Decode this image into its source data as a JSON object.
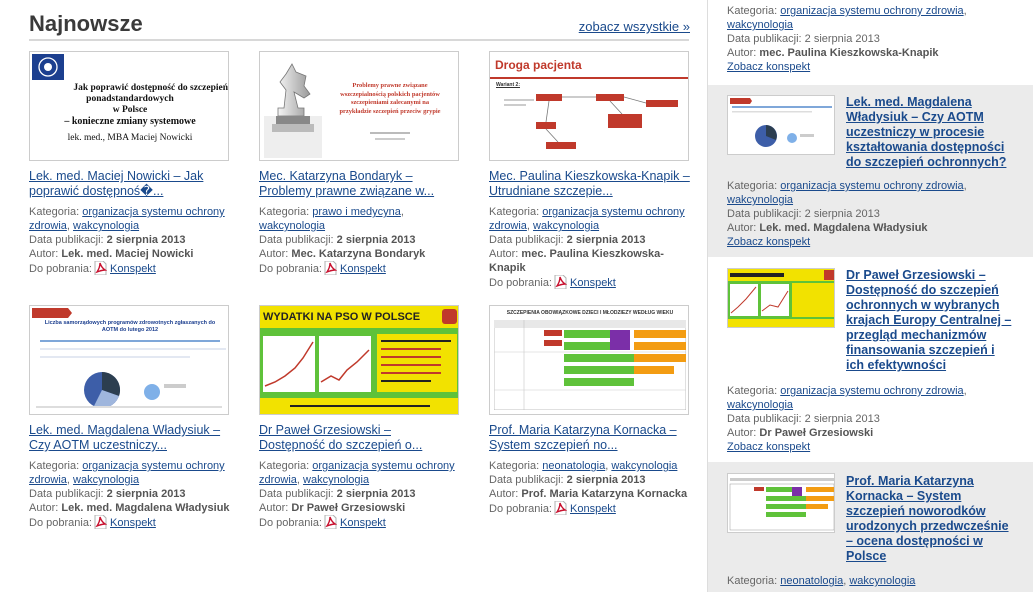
{
  "main": {
    "title": "Najnowsze",
    "see_all": "zobacz wszystkie »",
    "labels": {
      "category": "Kategoria:",
      "date": "Data publikacji:",
      "author": "Autor:",
      "download": "Do pobrania:"
    },
    "cards": [
      {
        "title": "Lek. med. Maciej Nowicki – Jak poprawić dostępnoś�...",
        "categories": [
          "organizacja systemu ochrony zdrowia",
          "wakcynologia"
        ],
        "date": "2 sierpnia 2013",
        "author": "Lek. med. Maciej Nowicki",
        "download": "Konspekt",
        "thumb": {
          "lines": [
            "Jak poprawić dostępność do szczepień",
            "ponadstandardowych",
            "w Polsce",
            "– konieczne zmiany systemowe",
            "lek. med., MBA Maciej Nowicki"
          ]
        }
      },
      {
        "title": "Mec. Katarzyna Bondaryk – Problemy prawne związane w...",
        "categories": [
          "prawo i medycyna",
          "wakcynologia"
        ],
        "date": "2 sierpnia 2013",
        "author": "Mec. Katarzyna Bondaryk",
        "download": "Konspekt",
        "thumb": {
          "lines": [
            "Problemy prawne związane",
            "wszczepialnością polskich pacjentów",
            "szczepieniami zalecanymi na",
            "przykładzie szczepień przeciw grypie"
          ]
        }
      },
      {
        "title": "Mec. Paulina Kieszkowska-Knapik – Utrudniane szczepie...",
        "categories": [
          "organizacja systemu ochrony zdrowia",
          "wakcynologia"
        ],
        "date": "2 sierpnia 2013",
        "author": "mec. Paulina Kieszkowska-Knapik",
        "download": "Konspekt",
        "thumb": {
          "lines": [
            "Droga pacjenta",
            "Wariant 2:"
          ]
        }
      },
      {
        "title": "Lek. med. Magdalena Władysiuk – Czy AOTM uczestniczy...",
        "categories": [
          "organizacja systemu ochrony zdrowia",
          "wakcynologia"
        ],
        "date": "2 sierpnia 2013",
        "author": "Lek. med. Magdalena Władysiuk",
        "download": "Konspekt",
        "thumb": {
          "lines": [
            "Liczba samorządowych programów zdrowotnych zgłaszanych do",
            "AOTM do lutego 2012"
          ]
        }
      },
      {
        "title": "Dr Paweł Grzesiowski – Dostępność do szczepień o...",
        "categories": [
          "organizacja systemu ochrony zdrowia",
          "wakcynologia"
        ],
        "date": "2 sierpnia 2013",
        "author": "Dr Paweł Grzesiowski",
        "download": "Konspekt",
        "thumb": {
          "lines": [
            "WYDATKI NA PSO W POLSCE"
          ]
        }
      },
      {
        "title": "Prof. Maria Katarzyna Kornacka – System szczepień no...",
        "categories": [
          "neonatologia",
          "wakcynologia"
        ],
        "date": "2 sierpnia 2013",
        "author": "Prof. Maria Katarzyna Kornacka",
        "download": "Konspekt",
        "thumb": {
          "lines": [
            "SZCZEPIENIA OBOWIĄZKOWE DZIECI I MŁODZIEŻY WEDŁUG WIEKU"
          ]
        }
      }
    ]
  },
  "sidebar": {
    "labels": {
      "category": "Kategoria:",
      "date": "Data publikacji:",
      "author": "Autor:",
      "more": "Zobacz konspekt"
    },
    "top": {
      "categories": [
        "organizacja systemu ochrony zdrowia",
        "wakcynologia"
      ],
      "date": "2 sierpnia 2013",
      "author": "mec. Paulina Kieszkowska-Knapik",
      "more": "Zobacz konspekt"
    },
    "items": [
      {
        "title": "Lek. med. Magdalena Władysiuk – Czy AOTM uczestniczy w procesie kształtowania dostępności do szczepień ochronnych?",
        "categories": [
          "organizacja systemu ochrony zdrowia",
          "wakcynologia"
        ],
        "date": "2 sierpnia 2013",
        "author": "Lek. med. Magdalena Władysiuk",
        "more": "Zobacz konspekt"
      },
      {
        "title": "Dr Paweł Grzesiowski – Dostępność do szczepień ochronnych w wybranych krajach Europy Centralnej – przegląd mechanizmów finansowania szczepień i ich efektywności",
        "categories": [
          "organizacja systemu ochrony zdrowia",
          "wakcynologia"
        ],
        "date": "2 sierpnia 2013",
        "author": "Dr Paweł Grzesiowski",
        "more": "Zobacz konspekt"
      },
      {
        "title": "Prof. Maria Katarzyna Kornacka – System szczepień noworodków urodzonych przedwcześnie – ocena dostępności w Polsce",
        "categories": [
          "neonatologia",
          "wakcynologia"
        ],
        "date": "",
        "author": "",
        "more": ""
      }
    ]
  },
  "icons": {
    "pdf": "pdf-icon",
    "knight": "chess-knight-icon",
    "logo": "logo-badge-icon"
  },
  "colors": {
    "link": "#1a4a8c",
    "heading": "#3a3a3a",
    "pdf_red": "#c8102e",
    "sidebar_bg": "#ebebeb"
  }
}
